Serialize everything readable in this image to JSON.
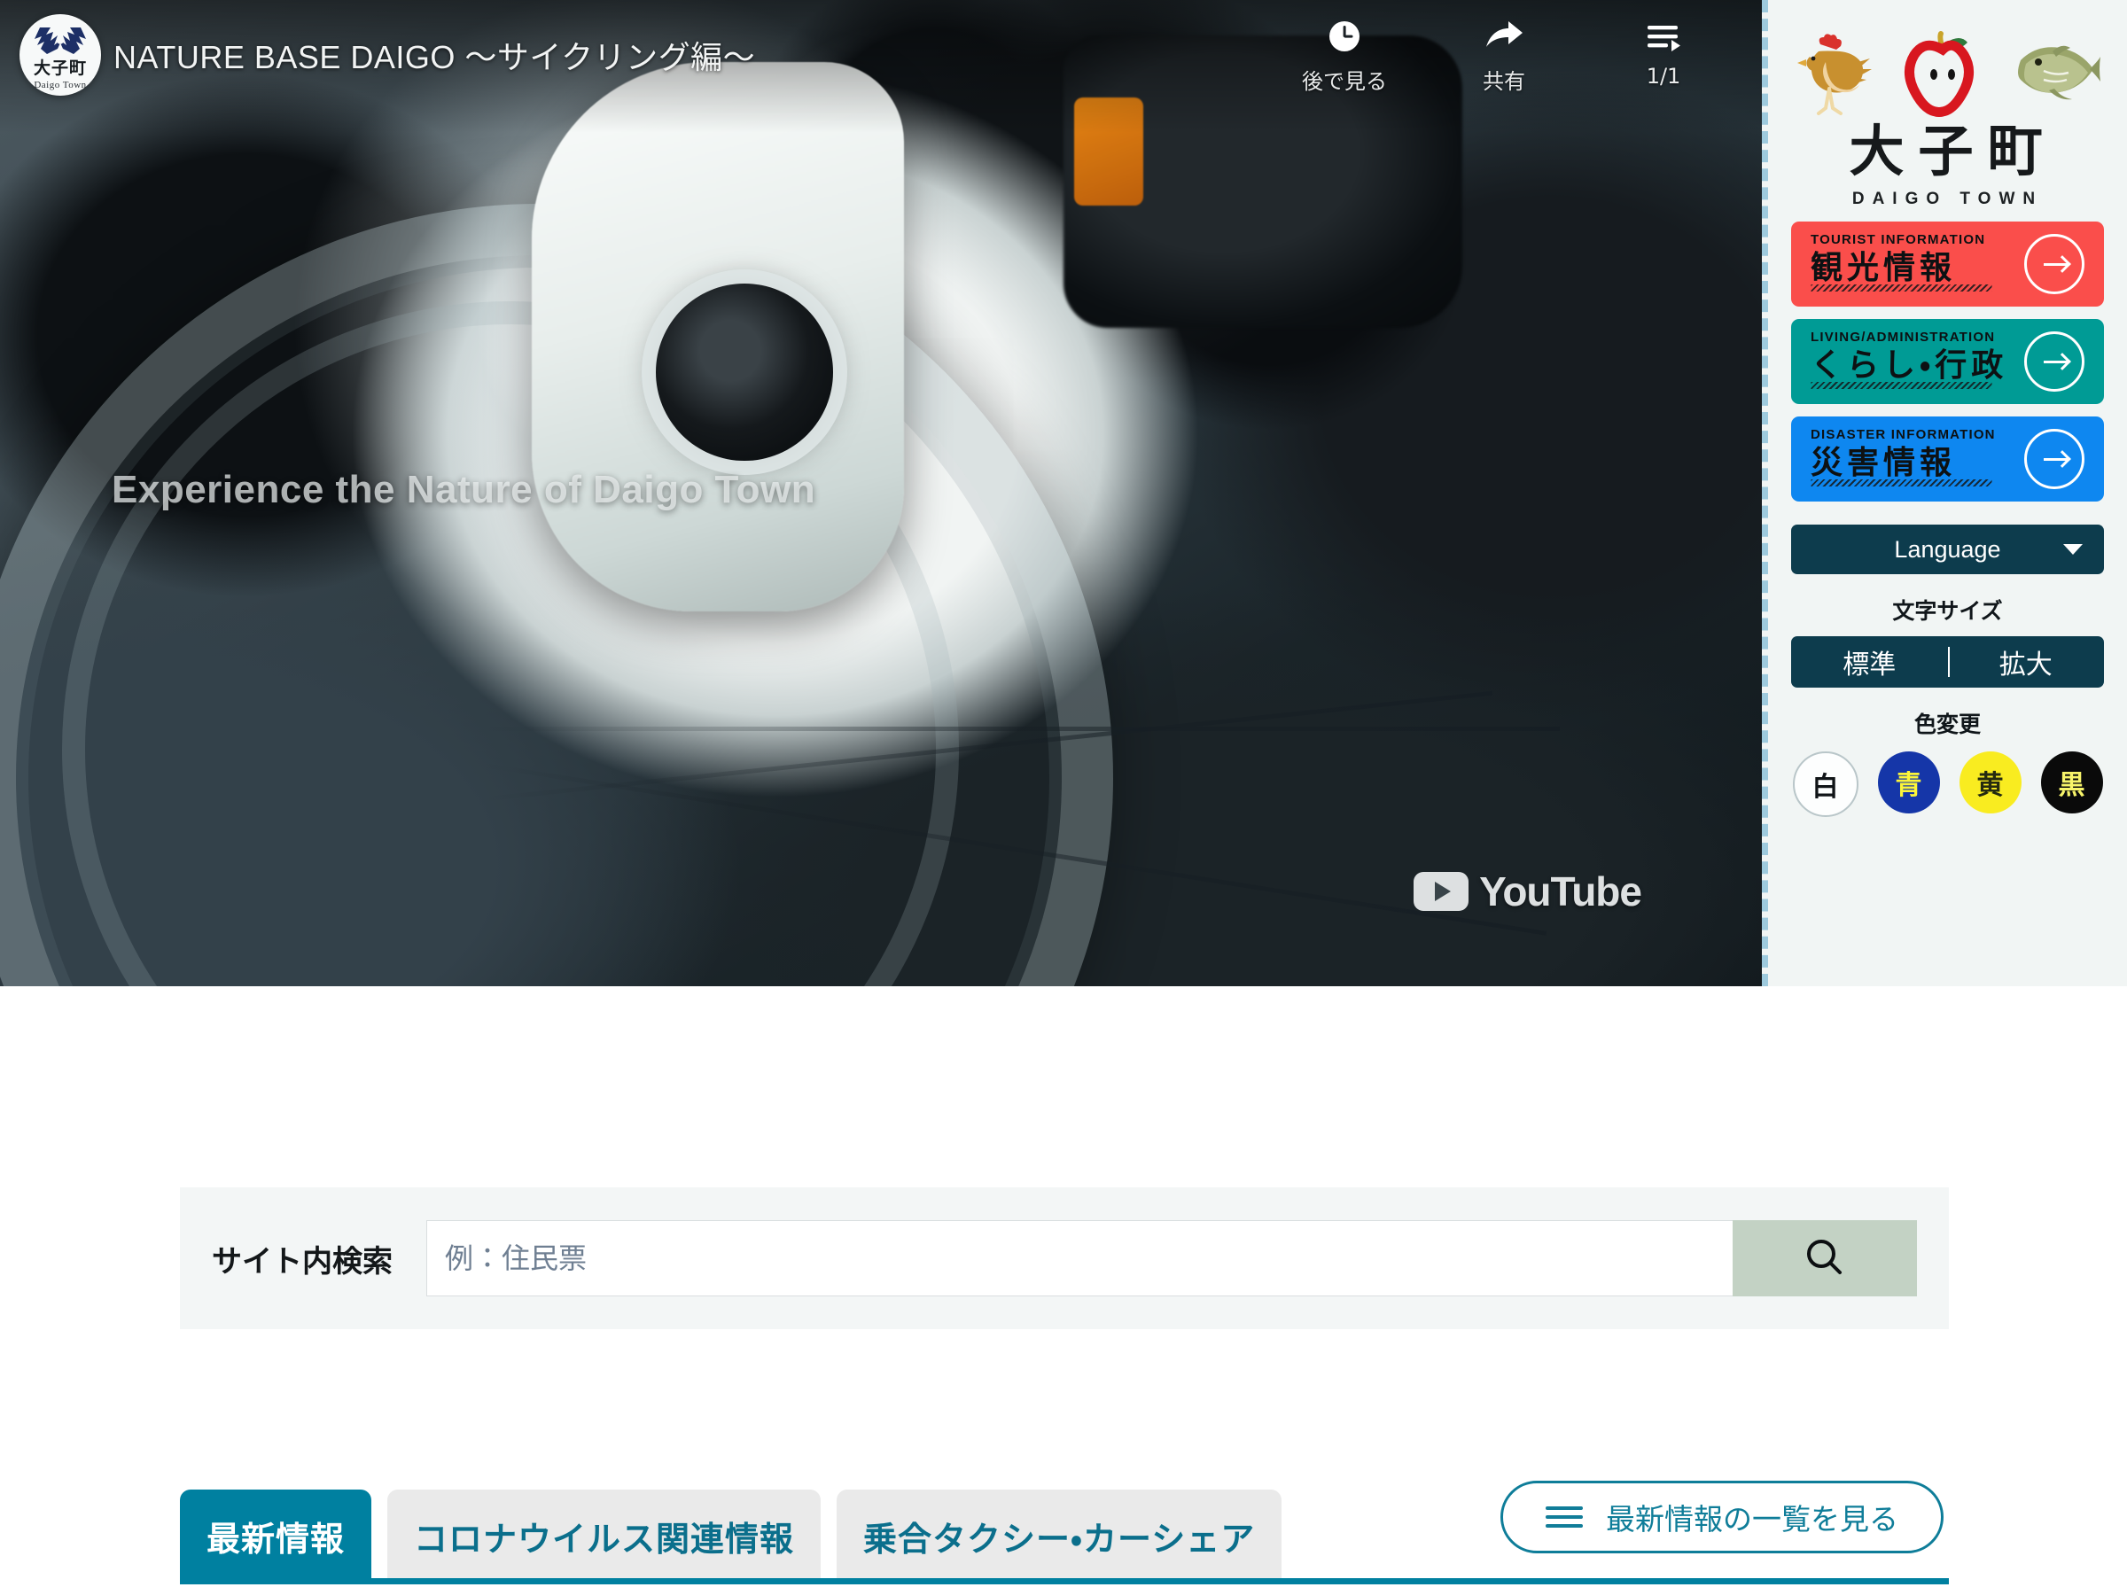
{
  "video": {
    "title": "NATURE BASE DAIGO ～サイクリング編～",
    "overlay_text": "Experience the Nature of Daigo Town",
    "watermark": "YouTube",
    "badge": {
      "kanji": "大子町",
      "romaji": "Daigo Town"
    },
    "controls": [
      {
        "icon": "clock-icon",
        "label": "後で見る"
      },
      {
        "icon": "share-arrow-icon",
        "label": "共有"
      },
      {
        "icon": "playlist-icon",
        "label": "1/1"
      }
    ]
  },
  "sidebar": {
    "logo": {
      "icons": [
        "chicken-icon",
        "apple-icon",
        "fish-icon"
      ],
      "kanji": [
        "大",
        "子",
        "町"
      ],
      "romaji": "DAIGO TOWN"
    },
    "nav_cards": [
      {
        "en": "TOURIST INFORMATION",
        "jp": "観光情報",
        "color": "#fa4e4b"
      },
      {
        "en": "LIVING/ADMINISTRATION",
        "jp": "くらし・行政",
        "color": "#009b95"
      },
      {
        "en": "DISASTER INFORMATION",
        "jp": "災害情報",
        "color": "#0e87f0"
      }
    ],
    "language": {
      "label": "Language"
    },
    "text_size": {
      "heading": "文字サイズ",
      "options": [
        "標準",
        "拡大"
      ]
    },
    "color_change": {
      "heading": "色変更",
      "options": [
        {
          "label": "白",
          "bg": "#fdfefe"
        },
        {
          "label": "青",
          "bg": "#1536a8"
        },
        {
          "label": "黄",
          "bg": "#f9ec20"
        },
        {
          "label": "黒",
          "bg": "#0a0a0a"
        }
      ]
    }
  },
  "search": {
    "label": "サイト内検索",
    "placeholder": "例：住民票",
    "value": "",
    "button_icon": "search-icon"
  },
  "tabs": {
    "items": [
      {
        "label": "最新情報",
        "active": true
      },
      {
        "label": "コロナウイルス関連情報",
        "active": false
      },
      {
        "label": "乗合タクシー・カーシェア",
        "active": false
      }
    ],
    "view_all": {
      "icon": "hamburger-icon",
      "label": "最新情報の一覧を見る"
    }
  }
}
